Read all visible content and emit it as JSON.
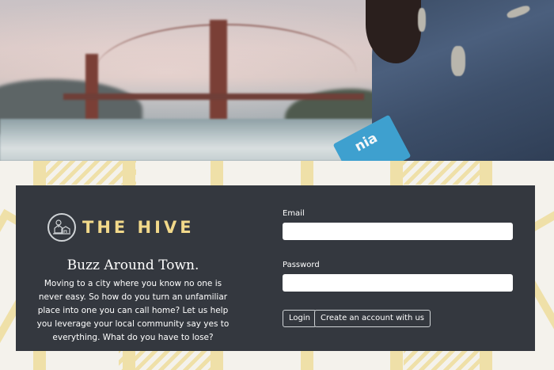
{
  "hero": {
    "book_text": "nia"
  },
  "brand": {
    "name": "THE HIVE",
    "logo_icon": "hive-house-icon",
    "accent_color": "#f2d98a"
  },
  "intro": {
    "tagline": "Buzz Around Town.",
    "description": "Moving to a city where you know no one is never easy. So how do you turn an unfamiliar place into one you can call home? Let us help you leverage your local community say yes to everything. What do you have to lose?"
  },
  "form": {
    "email_label": "Email",
    "email_value": "",
    "password_label": "Password",
    "password_value": "",
    "login_label": "Login",
    "create_account_label": "Create an account with us"
  },
  "colors": {
    "card_background": "#34383f",
    "pattern_accent": "#efe0a8"
  }
}
